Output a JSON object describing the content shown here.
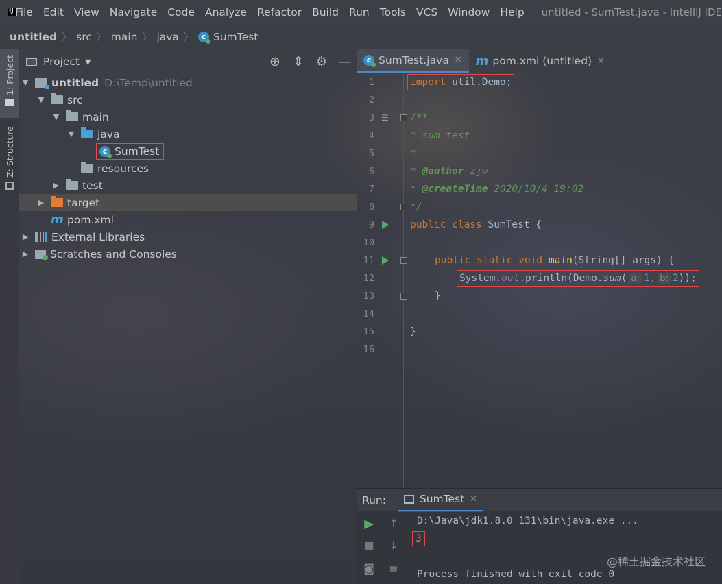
{
  "app": {
    "logo_text": "IJ",
    "window_title": "untitled - SumTest.java - IntelliJ IDEA"
  },
  "menu": [
    "File",
    "Edit",
    "View",
    "Navigate",
    "Code",
    "Analyze",
    "Refactor",
    "Build",
    "Run",
    "Tools",
    "VCS",
    "Window",
    "Help"
  ],
  "breadcrumb": [
    "untitled",
    "src",
    "main",
    "java",
    "SumTest"
  ],
  "tool_strip": {
    "project_tab": "1: Project",
    "structure_tab": "Z: Structure"
  },
  "project_panel": {
    "title": "Project",
    "icons": [
      "locate-icon",
      "collapse-icon",
      "gear-icon",
      "hide-icon"
    ],
    "tree": [
      {
        "label": "untitled",
        "path": "D:\\Temp\\untitled"
      },
      {
        "label": "src"
      },
      {
        "label": "main"
      },
      {
        "label": "java"
      },
      {
        "label": "SumTest"
      },
      {
        "label": "resources"
      },
      {
        "label": "test"
      },
      {
        "label": "target"
      },
      {
        "label": "pom.xml"
      },
      {
        "label": "External Libraries"
      },
      {
        "label": "Scratches and Consoles"
      }
    ]
  },
  "editor": {
    "tabs": [
      {
        "label": "SumTest.java",
        "active": true
      },
      {
        "label": "pom.xml (untitled)",
        "active": false
      }
    ],
    "line_numbers": [
      "1",
      "2",
      "3",
      "4",
      "5",
      "6",
      "7",
      "8",
      "9",
      "10",
      "11",
      "12",
      "13",
      "14",
      "15",
      "16"
    ],
    "code": {
      "l1_kw": "import",
      "l1_rest": " util.Demo;",
      "l3": "/**",
      "l4": " * sum test",
      "l5": " *",
      "l6_star": " * ",
      "l6_tag": "@author",
      "l6_val": " zjw",
      "l7_star": " * ",
      "l7_tag": "@createTime",
      "l7_val": " 2020/10/4 19:02",
      "l8": " */",
      "l9_kw": "public class",
      "l9_rest": " SumTest {",
      "l11_kw": "public static void",
      "l11_method": "main",
      "l11_rest": "(String[] args) {",
      "l12_a": "System.",
      "l12_out": "out",
      "l12_b": ".println(Demo.",
      "l12_sum": "sum",
      "l12_c": "(",
      "l12_hint_a": "a:",
      "l12_arg1": "1",
      "l12_comma": ",",
      "l12_hint_b": "b:",
      "l12_arg2": "2",
      "l12_end": "));",
      "l13": "}",
      "l15": "}"
    }
  },
  "run_panel": {
    "label": "Run:",
    "tab": "SumTest",
    "console": {
      "command": "D:\\Java\\jdk1.8.0_131\\bin\\java.exe ...",
      "output": "3",
      "exit": "Process finished with exit code 0"
    }
  },
  "watermark": "@稀土掘金技术社区",
  "colors": {
    "keyword": "#cc7832",
    "doc_comment": "#629755",
    "method": "#ffc66d",
    "static_field": "#9876aa",
    "number": "#6897bb",
    "highlight_box": "#e04848",
    "run_green": "#59a869"
  }
}
